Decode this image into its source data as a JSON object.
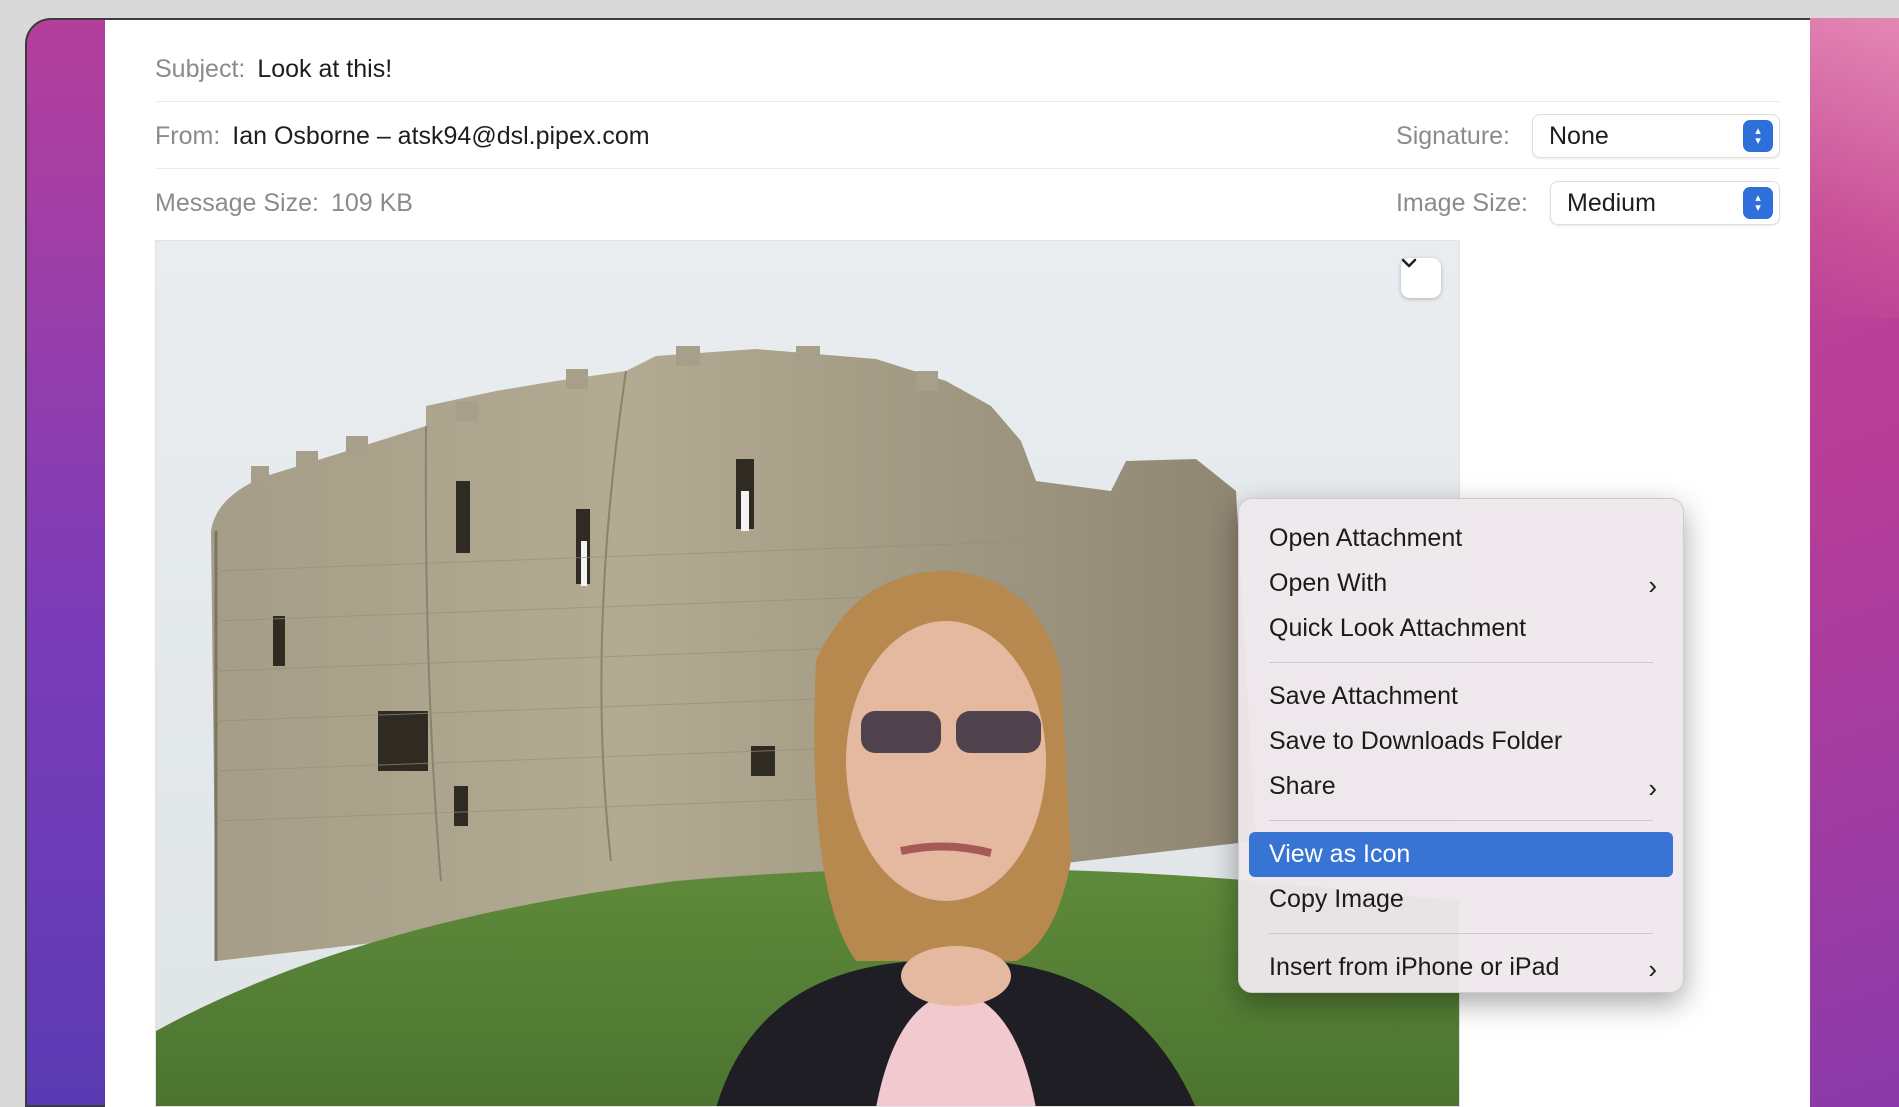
{
  "header": {
    "subject_label": "Subject:",
    "subject_value": "Look at this!",
    "from_label": "From:",
    "from_value": "Ian Osborne – atsk94@dsl.pipex.com",
    "signature_label": "Signature:",
    "signature_value": "None",
    "size_label": "Message Size:",
    "size_value": "109 KB",
    "image_size_label": "Image Size:",
    "image_size_value": "Medium"
  },
  "attachment": {
    "toggle_icon": "chevron-down-icon"
  },
  "context_menu": {
    "groups": [
      [
        {
          "label": "Open Attachment",
          "submenu": false
        },
        {
          "label": "Open With",
          "submenu": true
        },
        {
          "label": "Quick Look Attachment",
          "submenu": false
        }
      ],
      [
        {
          "label": "Save Attachment",
          "submenu": false
        },
        {
          "label": "Save to Downloads Folder",
          "submenu": false
        },
        {
          "label": "Share",
          "submenu": true
        }
      ],
      [
        {
          "label": "View as Icon",
          "submenu": false,
          "selected": true
        },
        {
          "label": "Copy Image",
          "submenu": false
        }
      ],
      [
        {
          "label": "Insert from iPhone or iPad",
          "submenu": true
        }
      ]
    ],
    "highlight_color": "#3774d4"
  },
  "colors": {
    "accent": "#2f6fd9"
  }
}
